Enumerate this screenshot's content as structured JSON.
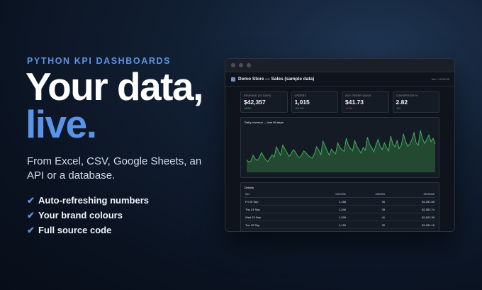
{
  "hero": {
    "eyebrow": "PYTHON KPI DASHBOARDS",
    "headline_line1": "Your data,",
    "headline_line2": "live.",
    "subtitle": "From Excel, CSV, Google Sheets, an API or a database.",
    "bullets": [
      {
        "icon": "check-icon",
        "text": "Auto-refreshing numbers"
      },
      {
        "icon": "check-icon",
        "text": "Your brand colours"
      },
      {
        "icon": "check-icon",
        "text": "Full source code"
      }
    ]
  },
  "dashboard": {
    "title": "Demo Store — Sales (sample data)",
    "updated": "live • 12:00:00",
    "kpis": [
      {
        "label": "Revenue (30 days)",
        "value": "$42,357",
        "delta": "+8.8%",
        "trend": "up"
      },
      {
        "label": "Orders",
        "value": "1,015",
        "delta": "+10.0%",
        "trend": "up"
      },
      {
        "label": "Avg order value",
        "value": "$41.73",
        "delta": "-1.1%",
        "trend": "down"
      },
      {
        "label": "Conversion %",
        "value": "2.82",
        "delta": "-3%",
        "trend": "up"
      }
    ],
    "chart_title": "Daily revenue — last 90 days",
    "table": {
      "title": "Details",
      "columns": [
        "Day",
        "Visitors",
        "Orders",
        "Revenue"
      ],
      "rows": [
        [
          "Fri 26 Sep",
          "1,188",
          "30",
          "$1,251.65"
        ],
        [
          "Thu 24 Sep",
          "1,246",
          "39",
          "$1,552.74"
        ],
        [
          "Wed 23 Sep",
          "1,295",
          "41",
          "$1,622.30"
        ],
        [
          "Tue 02 Sep",
          "1,129",
          "30",
          "$1,234.16"
        ]
      ]
    }
  },
  "colors": {
    "accent": "#5a93ea",
    "line": "#3fae5e",
    "area": "#234a31"
  },
  "chart_data": {
    "type": "area",
    "title": "Daily revenue — last 90 days",
    "values": [
      22,
      18,
      20,
      30,
      24,
      21,
      26,
      35,
      28,
      22,
      19,
      25,
      31,
      27,
      45,
      38,
      30,
      48,
      42,
      35,
      28,
      33,
      40,
      36,
      29,
      26,
      31,
      38,
      34,
      30,
      27,
      25,
      33,
      45,
      39,
      31,
      55,
      47,
      38,
      30,
      41,
      36,
      33,
      52,
      44,
      40,
      37,
      60,
      48,
      42,
      38,
      56,
      46,
      40,
      34,
      44,
      39,
      62,
      50,
      44,
      36,
      48,
      58,
      46,
      40,
      52,
      44,
      38,
      64,
      50,
      45,
      56,
      42,
      48,
      68,
      55,
      46,
      50,
      58,
      70,
      52,
      48,
      74,
      60,
      51,
      58,
      66,
      54,
      60,
      50
    ]
  }
}
